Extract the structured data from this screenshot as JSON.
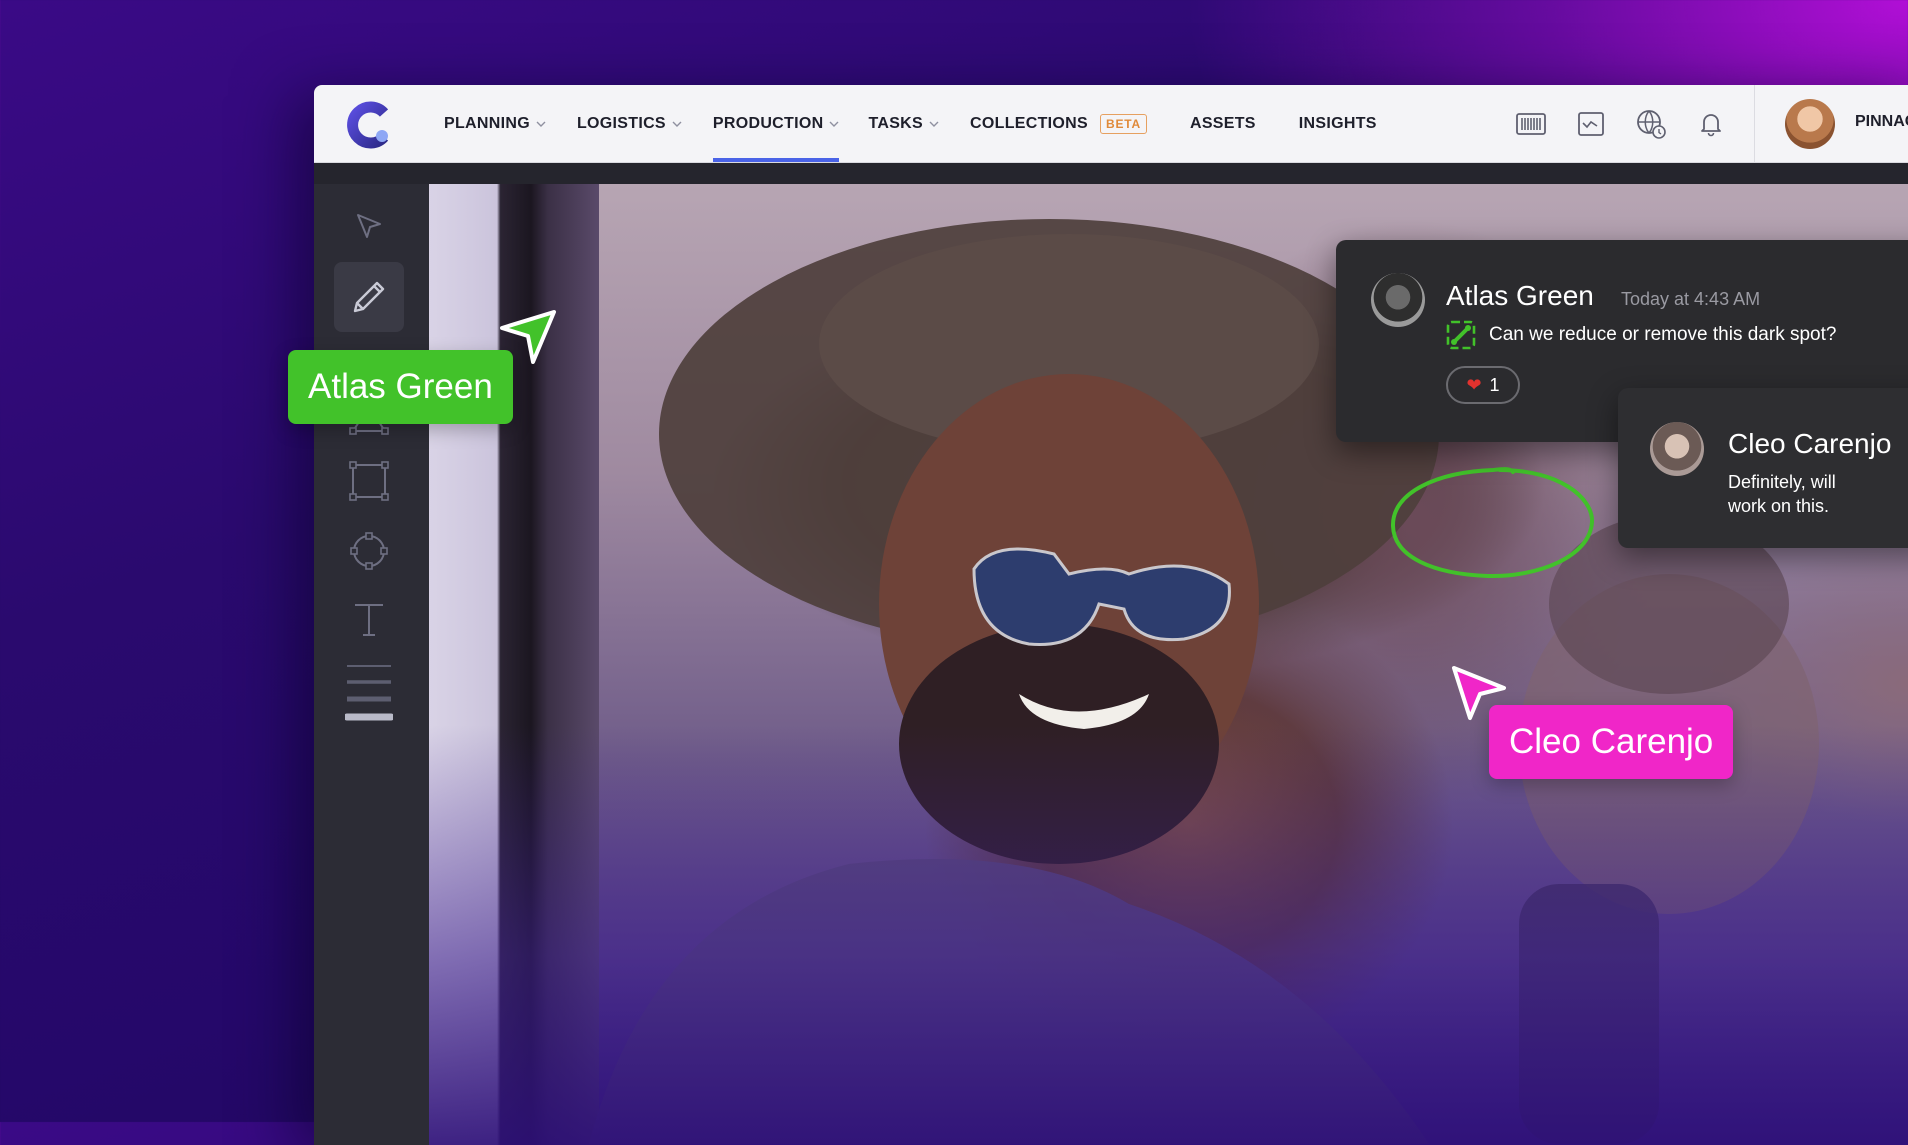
{
  "nav": {
    "items": [
      {
        "label": "PLANNING",
        "has_dropdown": true
      },
      {
        "label": "LOGISTICS",
        "has_dropdown": true
      },
      {
        "label": "PRODUCTION",
        "has_dropdown": true,
        "active": true
      },
      {
        "label": "TASKS",
        "has_dropdown": true
      },
      {
        "label": "COLLECTIONS",
        "badge": "BETA"
      },
      {
        "label": "ASSETS"
      },
      {
        "label": "INSIGHTS"
      }
    ]
  },
  "toolbar_icons": [
    "barcode-icon",
    "chart-window-icon",
    "globe-clock-icon",
    "bell-icon"
  ],
  "user": {
    "name": "PINNAC"
  },
  "tools": [
    "select-arrow-icon",
    "pencil-icon",
    "pen-path-icon",
    "triangle-icon",
    "rectangle-icon",
    "circle-node-icon",
    "text-icon",
    "stroke-width-icon"
  ],
  "comment": {
    "author": "Atlas Green",
    "time": "Today at 4:43 AM",
    "text": "Can we reduce or remove this dark spot?",
    "reaction_emoji": "❤",
    "reaction_count": "1"
  },
  "reply": {
    "author": "Cleo Carenjo",
    "text": "Definitely, will work on this."
  },
  "cursors": {
    "green": {
      "label": "Atlas Green",
      "color": "#42c22a"
    },
    "pink": {
      "label": "Cleo Carenjo",
      "color": "#f026c8"
    }
  },
  "colors": {
    "accent": "#4a63e7",
    "beta": "#e08a3a",
    "annotation": "#42c22a"
  }
}
